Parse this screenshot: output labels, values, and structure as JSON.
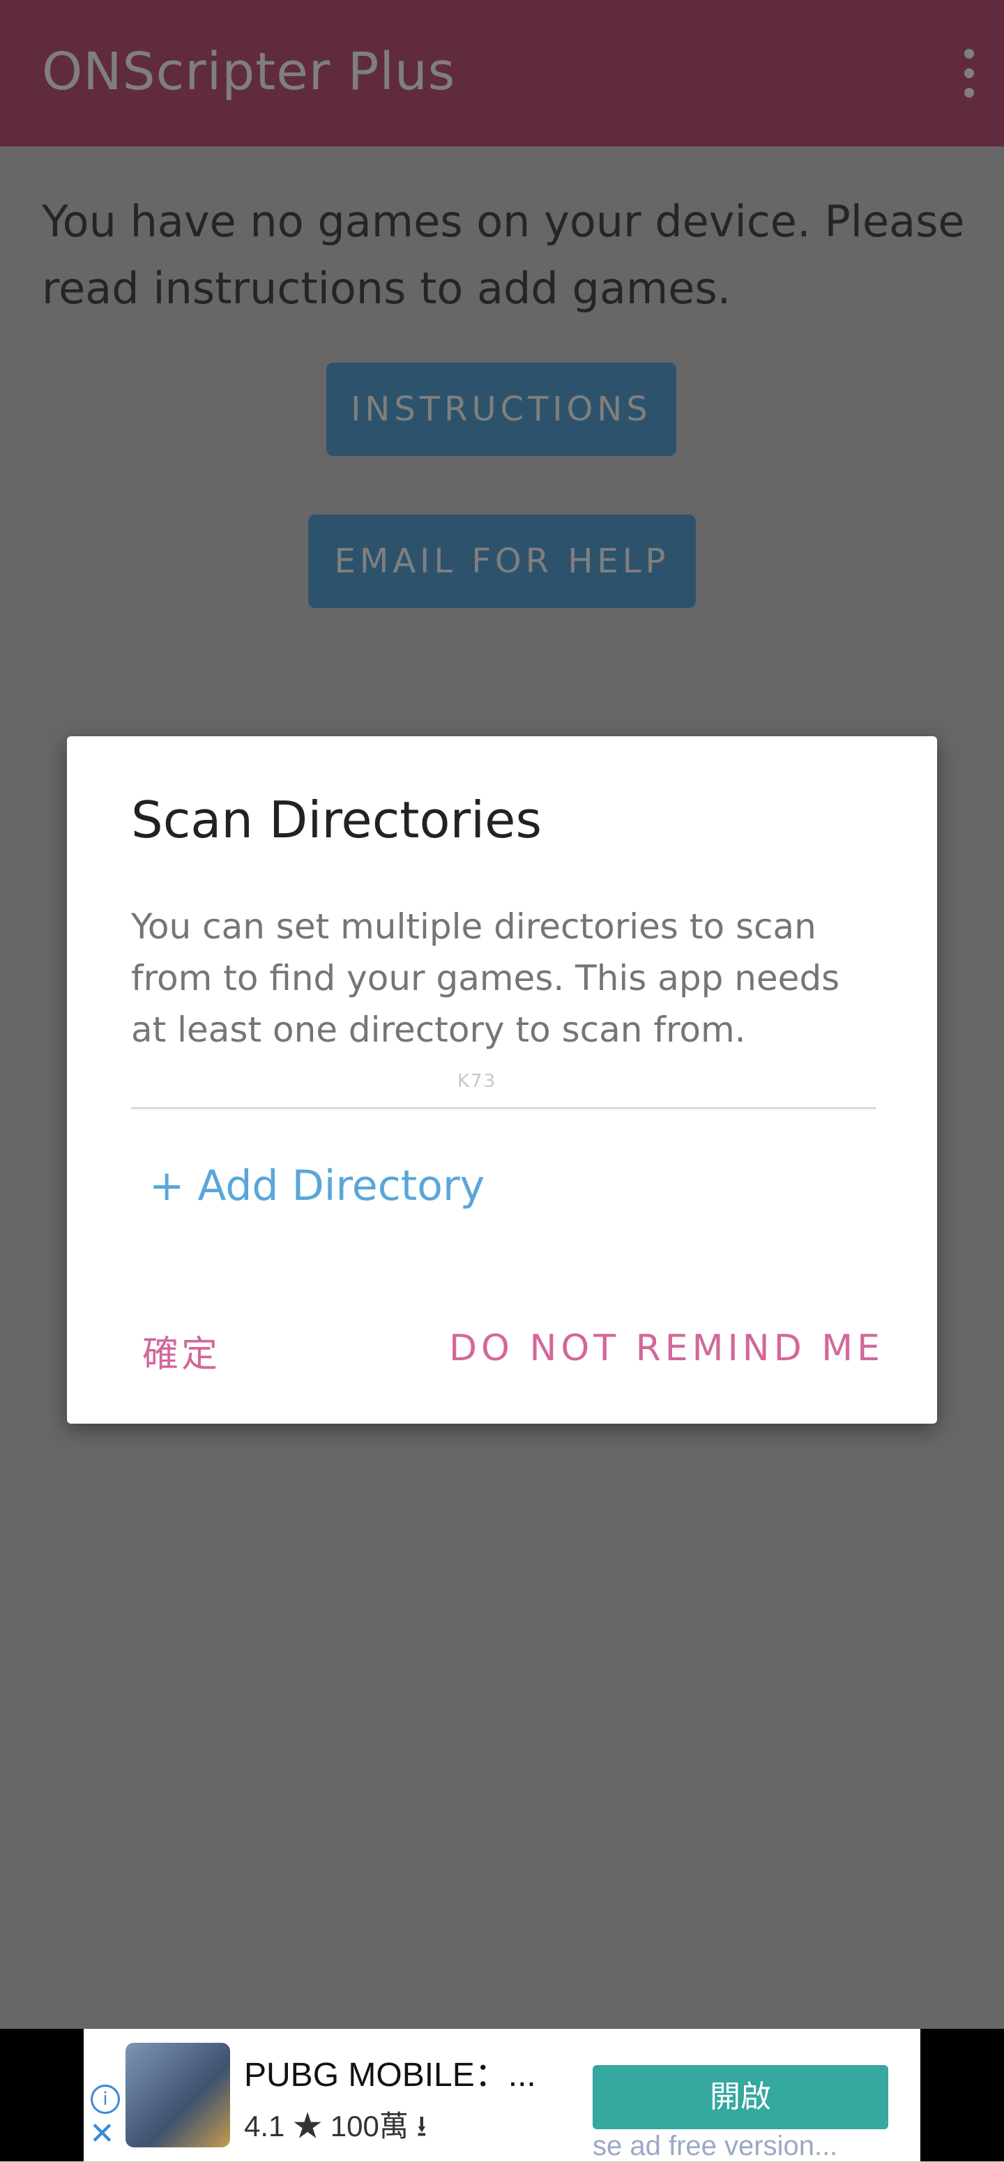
{
  "app_bar": {
    "title": "ONScripter Plus",
    "menu_icon": "overflow-menu-icon",
    "color": "#c2577f"
  },
  "main": {
    "empty_message": "You have no games on your device. Please read instructions to add games.",
    "instructions_label": "INSTRUCTIONS",
    "email_label": "EMAIL FOR HELP"
  },
  "dialog": {
    "title": "Scan Directories",
    "body": "You can set multiple directories to scan from to find your games. This app needs at least one directory to scan from.",
    "watermark": "K73",
    "add_directory_label": "+ Add Directory",
    "confirm_label": "確定",
    "do_not_remind_label": "DO NOT REMIND ME",
    "accent_color": "#d3679a",
    "link_color": "#5aa6d9"
  },
  "ad": {
    "title": "PUBG MOBILE：...",
    "rating": "4.1",
    "star_icon": "star-icon",
    "downloads": "100萬",
    "download_icon": "download-icon",
    "open_label": "開啟",
    "subtext": "se ad free version...",
    "info_icon": "info-icon",
    "close_icon": "close-icon"
  }
}
